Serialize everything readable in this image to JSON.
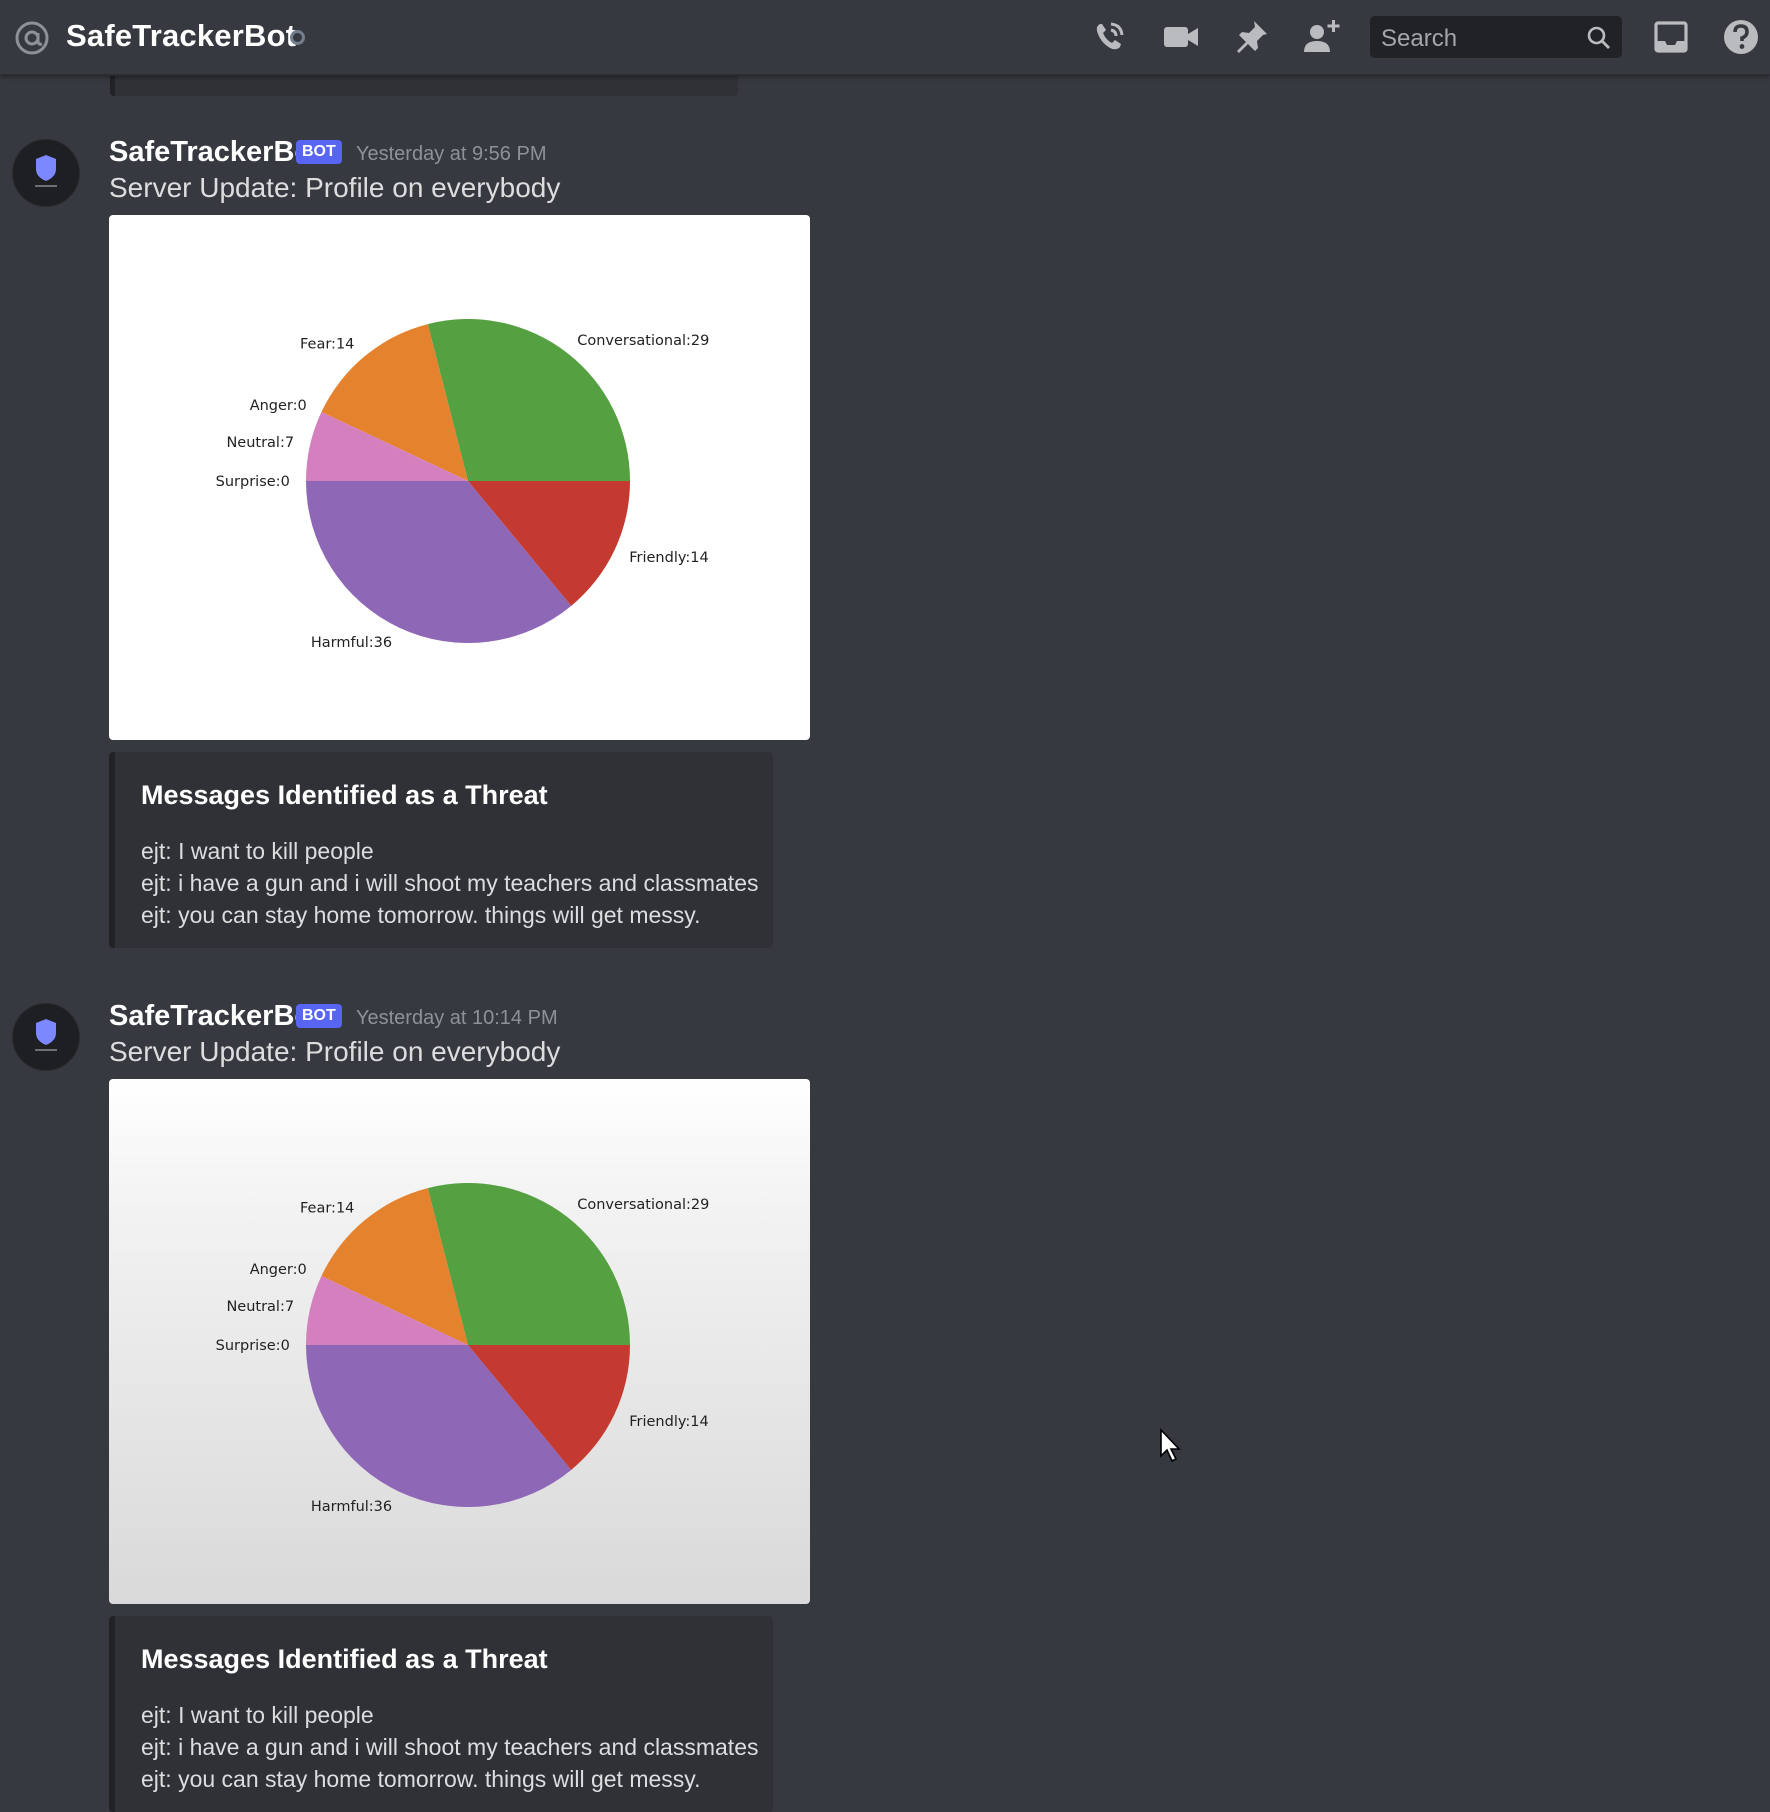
{
  "header": {
    "channel_name": "SafeTrackerBot",
    "search_placeholder": "Search",
    "icons": [
      "at-icon",
      "call-icon",
      "video-icon",
      "pin-icon",
      "add-member-icon",
      "search-icon",
      "inbox-icon",
      "help-icon"
    ]
  },
  "colors": {
    "background": "#36393f",
    "bot_tag": "#5865f2",
    "embed_bg": "#2f3136",
    "conversational": "#55a040",
    "fear": "#e5822e",
    "anger": "#d0504a",
    "neutral": "#d47fbe",
    "surprise": "#8c8c8c",
    "harmful": "#8f67b7",
    "friendly": "#c43a30"
  },
  "messages": [
    {
      "author": "SafeTrackerBot",
      "bot_tag": "BOT",
      "timestamp": "Yesterday at 9:56 PM",
      "content": "Server Update: Profile on everybody",
      "embed": {
        "title": "Messages Identified as a Threat",
        "lines": [
          "ejt: I want to kill people",
          "ejt: i have a gun and i will shoot my teachers and classmates",
          "ejt: you can stay home tomorrow. things will get messy."
        ]
      }
    },
    {
      "author": "SafeTrackerBot",
      "bot_tag": "BOT",
      "timestamp": "Yesterday at 10:14 PM",
      "content": "Server Update: Profile on everybody",
      "embed": {
        "title": "Messages Identified as a Threat",
        "lines": [
          "ejt: I want to kill people",
          "ejt: i have a gun and i will shoot my teachers and classmates",
          "ejt: you can stay home tomorrow. things will get messy."
        ]
      }
    }
  ],
  "chart_data": [
    {
      "type": "pie",
      "categories": [
        "Conversational",
        "Fear",
        "Anger",
        "Neutral",
        "Surprise",
        "Harmful",
        "Friendly"
      ],
      "values": [
        29,
        14,
        0,
        7,
        0,
        36,
        14
      ],
      "labels": [
        "Conversational:29",
        "Fear:14",
        "Anger:0",
        "Neutral:7",
        "Surprise:0",
        "Harmful:36",
        "Friendly:14"
      ]
    },
    {
      "type": "pie",
      "categories": [
        "Conversational",
        "Fear",
        "Anger",
        "Neutral",
        "Surprise",
        "Harmful",
        "Friendly"
      ],
      "values": [
        29,
        14,
        0,
        7,
        0,
        36,
        14
      ],
      "labels": [
        "Conversational:29",
        "Fear:14",
        "Anger:0",
        "Neutral:7",
        "Surprise:0",
        "Harmful:36",
        "Friendly:14"
      ]
    }
  ]
}
